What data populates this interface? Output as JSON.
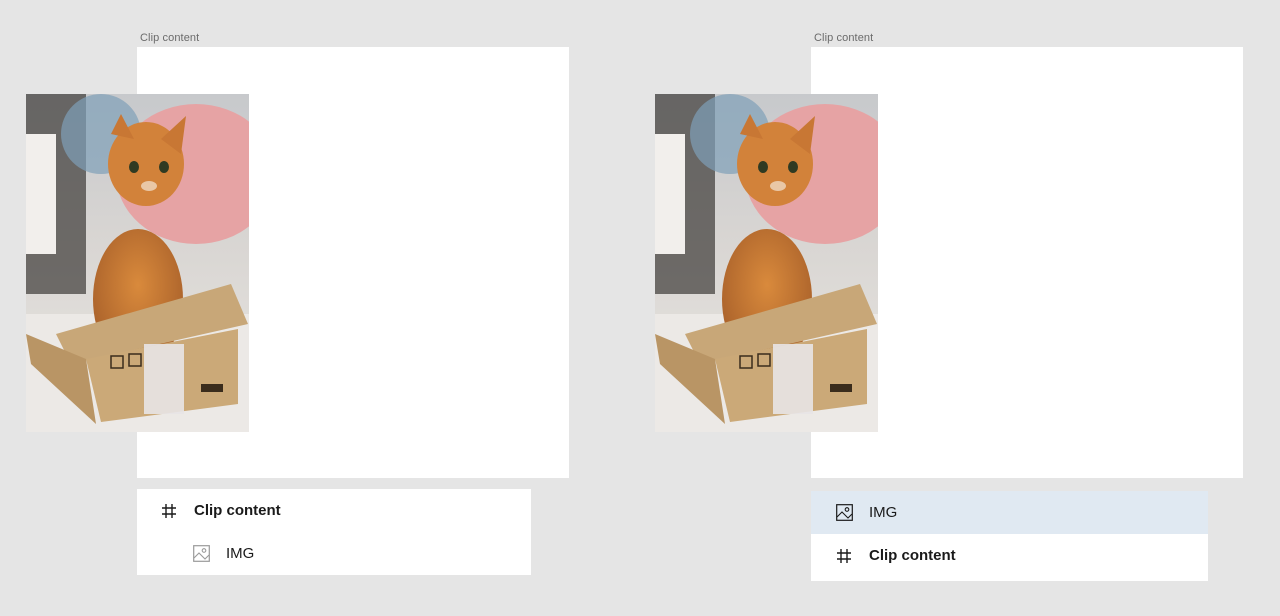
{
  "left_panel": {
    "frame_label": "Clip content",
    "layers": [
      {
        "label": "Clip content",
        "icon": "frame-hash-icon",
        "bold": true
      },
      {
        "label": "IMG",
        "icon": "image-icon",
        "bold": false
      }
    ]
  },
  "right_panel": {
    "frame_label": "Clip content",
    "layers": [
      {
        "label": "IMG",
        "icon": "image-icon",
        "bold": false,
        "selected": true
      },
      {
        "label": "Clip content",
        "icon": "frame-hash-icon",
        "bold": true
      }
    ]
  },
  "colors": {
    "canvas": "#e5e5e5",
    "frame": "#ffffff",
    "selection": "#e0e9f2"
  }
}
